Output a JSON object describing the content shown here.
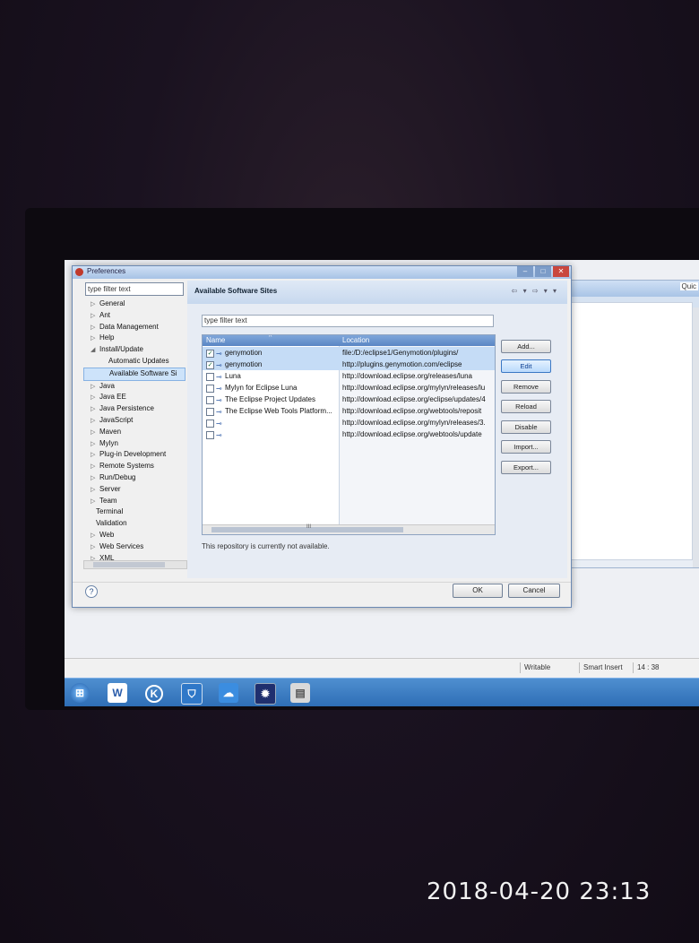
{
  "dialog": {
    "title": "Preferences",
    "filter_placeholder": "type filter text",
    "tree": [
      {
        "label": "General",
        "expander": "▷"
      },
      {
        "label": "Ant",
        "expander": "▷"
      },
      {
        "label": "Data Management",
        "expander": "▷"
      },
      {
        "label": "Help",
        "expander": "▷"
      },
      {
        "label": "Install/Update",
        "expander": "◢"
      },
      {
        "label": "Automatic Updates",
        "expander": ""
      },
      {
        "label": "Available Software Si",
        "expander": ""
      },
      {
        "label": "Java",
        "expander": "▷"
      },
      {
        "label": "Java EE",
        "expander": "▷"
      },
      {
        "label": "Java Persistence",
        "expander": "▷"
      },
      {
        "label": "JavaScript",
        "expander": "▷"
      },
      {
        "label": "Maven",
        "expander": "▷"
      },
      {
        "label": "Mylyn",
        "expander": "▷"
      },
      {
        "label": "Plug-in Development",
        "expander": "▷"
      },
      {
        "label": "Remote Systems",
        "expander": "▷"
      },
      {
        "label": "Run/Debug",
        "expander": "▷"
      },
      {
        "label": "Server",
        "expander": "▷"
      },
      {
        "label": "Team",
        "expander": "▷"
      },
      {
        "label": "Terminal",
        "expander": ""
      },
      {
        "label": "Validation",
        "expander": ""
      },
      {
        "label": "Web",
        "expander": "▷"
      },
      {
        "label": "Web Services",
        "expander": "▷"
      },
      {
        "label": "XML",
        "expander": "▷"
      }
    ],
    "page_title": "Available Software Sites",
    "nav_arrows": "⇦ ▾ ⇨ ▾ ▾",
    "right_filter_placeholder": "type filter text",
    "columns": {
      "name": "Name",
      "location": "Location"
    },
    "sites": [
      {
        "checked": "✓",
        "name": "genymotion",
        "location": "file:/D:/eclipse1/Genymotion/plugins/"
      },
      {
        "checked": "✓",
        "name": "genymotion",
        "location": "http://plugins.genymotion.com/eclipse"
      },
      {
        "checked": "",
        "name": "Luna",
        "location": "http://download.eclipse.org/releases/luna"
      },
      {
        "checked": "",
        "name": "Mylyn for Eclipse Luna",
        "location": "http://download.eclipse.org/mylyn/releases/lu"
      },
      {
        "checked": "",
        "name": "The Eclipse Project Updates",
        "location": "http://download.eclipse.org/eclipse/updates/4"
      },
      {
        "checked": "",
        "name": "The Eclipse Web Tools Platform...",
        "location": "http://download.eclipse.org/webtools/reposit"
      },
      {
        "checked": "",
        "name": "",
        "location": "http://download.eclipse.org/mylyn/releases/3."
      },
      {
        "checked": "",
        "name": "",
        "location": "http://download.eclipse.org/webtools/update"
      }
    ],
    "buttons": {
      "add": "Add...",
      "edit": "Edit",
      "remove": "Remove",
      "reload": "Reload",
      "disable": "Disable",
      "import": "Import...",
      "export": "Export..."
    },
    "status_message": "This repository is currently not available.",
    "help": "?",
    "ok": "OK",
    "cancel": "Cancel",
    "scroll_grip": "III"
  },
  "background_window": {
    "quick_access": "Quic"
  },
  "statusbar": {
    "writable": "Writable",
    "insert_mode": "Smart Insert",
    "position": "14 : 38"
  },
  "taskbar": {
    "word_label": "W"
  },
  "photo_timestamp": "2018-04-20  23:13"
}
